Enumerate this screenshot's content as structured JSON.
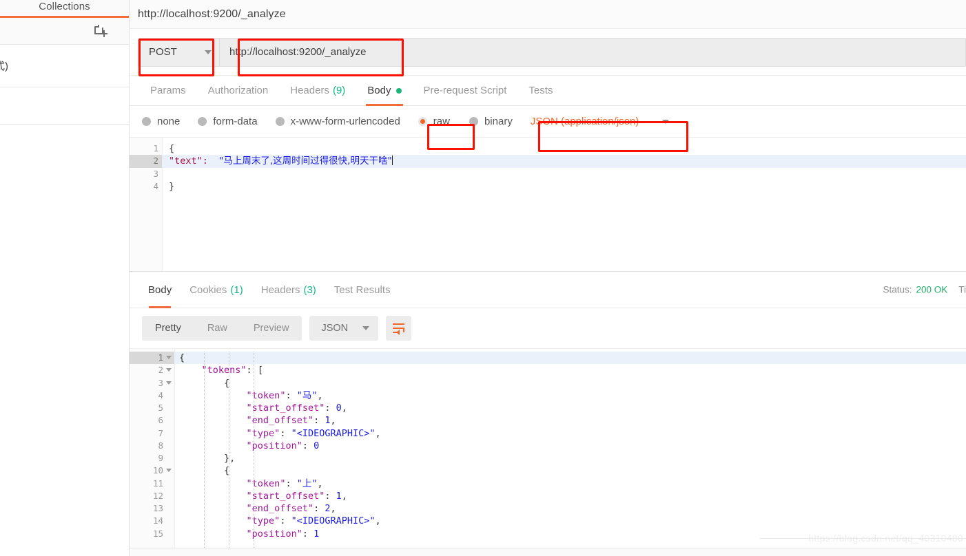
{
  "sidebar": {
    "tab_label": "Collections",
    "new_collection_icon": "new-collection-icon",
    "clipped_text": "式)"
  },
  "request": {
    "title": "http://localhost:9200/_analyze",
    "method": "POST",
    "url": "http://localhost:9200/_analyze",
    "tabs": [
      {
        "label": "Params",
        "count": "",
        "active": false
      },
      {
        "label": "Authorization",
        "count": "",
        "active": false
      },
      {
        "label": "Headers",
        "count": "(9)",
        "active": false
      },
      {
        "label": "Body",
        "count": "",
        "active": true
      },
      {
        "label": "Pre-request Script",
        "count": "",
        "active": false
      },
      {
        "label": "Tests",
        "count": "",
        "active": false
      }
    ],
    "body_types": [
      {
        "label": "none",
        "selected": false
      },
      {
        "label": "form-data",
        "selected": false
      },
      {
        "label": "x-www-form-urlencoded",
        "selected": false
      },
      {
        "label": "raw",
        "selected": true
      },
      {
        "label": "binary",
        "selected": false
      }
    ],
    "content_type": "JSON (application/json)",
    "editor": {
      "lines": [
        "1",
        "2",
        "3",
        "4"
      ],
      "line1": "{",
      "line2_key": "\"text\":",
      "line2_value": "\"马上周末了,这周时间过得很快,明天干啥\"",
      "line3": "",
      "line4": "}"
    }
  },
  "response": {
    "tabs": [
      {
        "label": "Body",
        "count": "",
        "active": true
      },
      {
        "label": "Cookies",
        "count": "(1)",
        "active": false
      },
      {
        "label": "Headers",
        "count": "(3)",
        "active": false
      },
      {
        "label": "Test Results",
        "count": "",
        "active": false
      }
    ],
    "status_label": "Status:",
    "status_value": "200 OK",
    "time_label": "Ti",
    "view_modes": [
      {
        "label": "Pretty",
        "active": true
      },
      {
        "label": "Raw",
        "active": false
      },
      {
        "label": "Preview",
        "active": false
      }
    ],
    "format": "JSON",
    "wrap_icon": "word-wrap-icon",
    "body_lines": [
      {
        "n": "1",
        "fold": true,
        "hl": true,
        "indent": 0,
        "text": "{"
      },
      {
        "n": "2",
        "fold": true,
        "hl": false,
        "indent": 1,
        "text": "\"tokens\": ["
      },
      {
        "n": "3",
        "fold": true,
        "hl": false,
        "indent": 2,
        "text": "{"
      },
      {
        "n": "4",
        "fold": false,
        "hl": false,
        "indent": 3,
        "text": "\"token\": \"马\","
      },
      {
        "n": "5",
        "fold": false,
        "hl": false,
        "indent": 3,
        "text": "\"start_offset\": 0,"
      },
      {
        "n": "6",
        "fold": false,
        "hl": false,
        "indent": 3,
        "text": "\"end_offset\": 1,"
      },
      {
        "n": "7",
        "fold": false,
        "hl": false,
        "indent": 3,
        "text": "\"type\": \"<IDEOGRAPHIC>\","
      },
      {
        "n": "8",
        "fold": false,
        "hl": false,
        "indent": 3,
        "text": "\"position\": 0"
      },
      {
        "n": "9",
        "fold": false,
        "hl": false,
        "indent": 2,
        "text": "},"
      },
      {
        "n": "10",
        "fold": true,
        "hl": false,
        "indent": 2,
        "text": "{"
      },
      {
        "n": "11",
        "fold": false,
        "hl": false,
        "indent": 3,
        "text": "\"token\": \"上\","
      },
      {
        "n": "12",
        "fold": false,
        "hl": false,
        "indent": 3,
        "text": "\"start_offset\": 1,"
      },
      {
        "n": "13",
        "fold": false,
        "hl": false,
        "indent": 3,
        "text": "\"end_offset\": 2,"
      },
      {
        "n": "14",
        "fold": false,
        "hl": false,
        "indent": 3,
        "text": "\"type\": \"<IDEOGRAPHIC>\","
      },
      {
        "n": "15",
        "fold": false,
        "hl": false,
        "indent": 3,
        "text": "\"position\": 1"
      }
    ]
  },
  "watermark": "https://blog.csdn.net/qq_40310480",
  "colors": {
    "accent": "#f26b3a",
    "annotation": "#fc1100",
    "success": "#23ad6b",
    "count_green": "#12b886"
  }
}
